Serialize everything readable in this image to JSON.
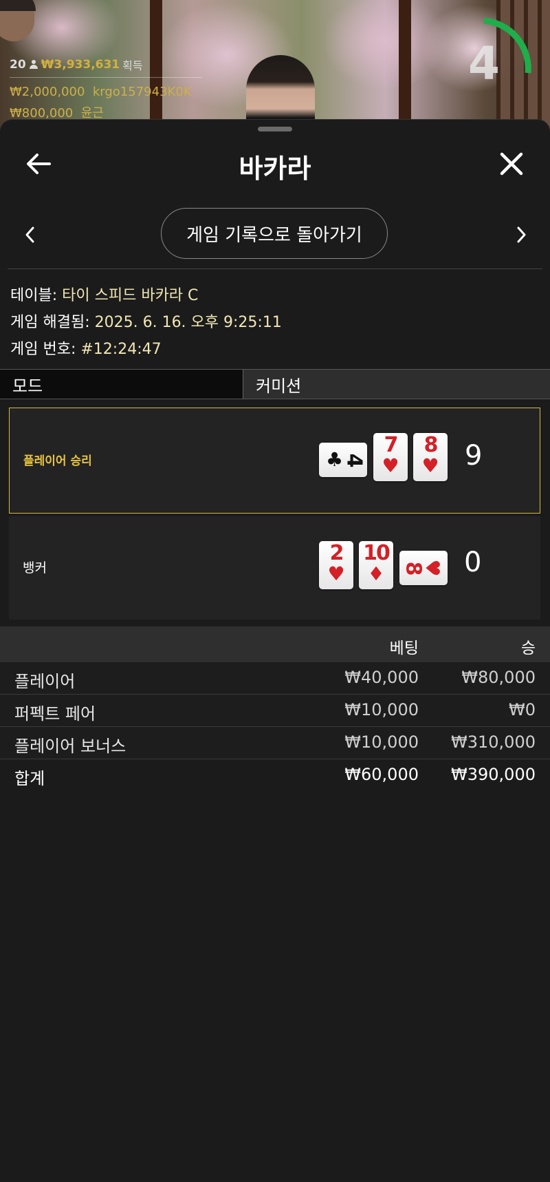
{
  "overlay": {
    "player_count": "20",
    "total_amount": "₩3,933,631",
    "total_suffix": "획득",
    "bets": [
      {
        "amount": "₩2,000,000",
        "user": "krgo157943K0K"
      },
      {
        "amount": "₩800,000",
        "user": "윤근"
      }
    ],
    "timer": "4"
  },
  "header": {
    "title": "바카라"
  },
  "nav": {
    "return_label": "게임 기록으로 돌아가기"
  },
  "info": {
    "table_label": "테이블:",
    "table_value": "타이 스피드 바카라 C",
    "resolved_label": "게임 해결됨:",
    "resolved_value": "2025. 6. 16. 오후 9:25:11",
    "number_label": "게임 번호:",
    "number_value": "#12:24:47"
  },
  "tabs": {
    "mode": "모드",
    "commission": "커미션"
  },
  "hands": {
    "player": {
      "label": "플레이어 승리",
      "score": "9",
      "cards": [
        {
          "rank": "4",
          "suit": "♣",
          "color": "black",
          "sideways": true
        },
        {
          "rank": "7",
          "suit": "♥",
          "color": "red",
          "sideways": false
        },
        {
          "rank": "8",
          "suit": "♥",
          "color": "red",
          "sideways": false
        }
      ]
    },
    "banker": {
      "label": "뱅커",
      "score": "0",
      "cards": [
        {
          "rank": "2",
          "suit": "♥",
          "color": "red",
          "sideways": false
        },
        {
          "rank": "10",
          "suit": "♦",
          "color": "red",
          "sideways": false
        },
        {
          "rank": "8",
          "suit": "♥",
          "color": "red",
          "sideways": true
        }
      ]
    }
  },
  "results": {
    "headers": {
      "bet": "베팅",
      "win": "승"
    },
    "rows": [
      {
        "name": "플레이어",
        "bet": "₩40,000",
        "win": "₩80,000"
      },
      {
        "name": "퍼펙트 페어",
        "bet": "₩10,000",
        "win": "₩0"
      },
      {
        "name": "플레이어 보너스",
        "bet": "₩10,000",
        "win": "₩310,000"
      }
    ],
    "total": {
      "name": "합계",
      "bet": "₩60,000",
      "win": "₩390,000"
    }
  },
  "colors": {
    "accent_gold": "#d8b94a",
    "card_red": "#d42026",
    "timer_green": "#1fae4b"
  }
}
